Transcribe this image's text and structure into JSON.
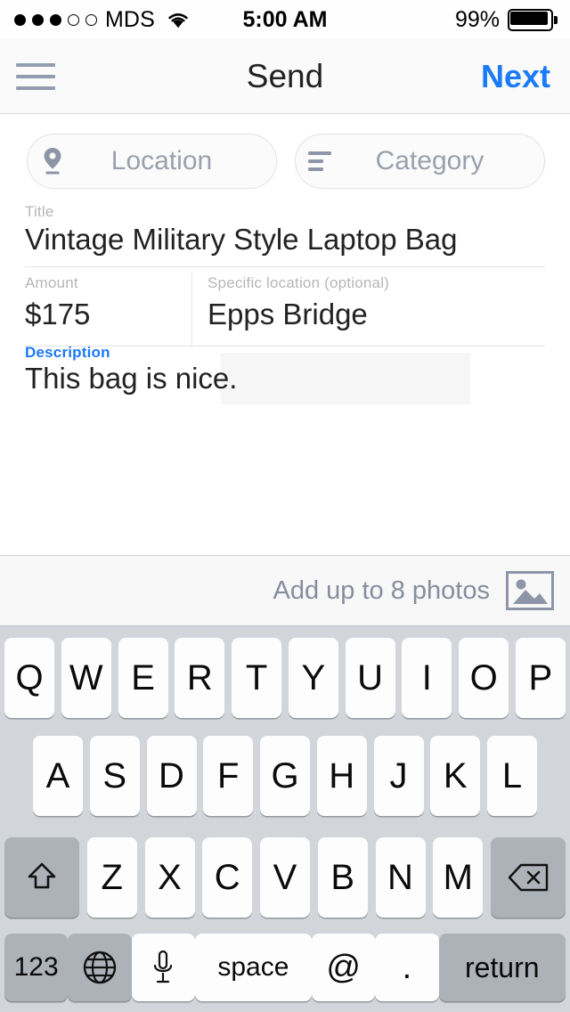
{
  "status_bar": {
    "signal_dots_filled": 3,
    "signal_dots_total": 5,
    "carrier": "MDS",
    "wifi_icon": "wifi-icon",
    "time": "5:00 AM",
    "battery_percent": "99%",
    "battery_icon": "battery-icon"
  },
  "nav": {
    "menu_icon": "hamburger-menu-icon",
    "title": "Send",
    "next_label": "Next"
  },
  "form": {
    "location_pill": {
      "icon": "map-pin-icon",
      "label": "Location"
    },
    "category_pill": {
      "icon": "list-lines-icon",
      "label": "Category"
    },
    "title_field": {
      "label": "Title",
      "value": "Vintage Military Style Laptop Bag"
    },
    "amount_field": {
      "label": "Amount",
      "value": "$175"
    },
    "specific_location_field": {
      "label": "Specific location (optional)",
      "value": "Epps Bridge"
    },
    "description_field": {
      "label": "Description",
      "value": "This bag is nice."
    }
  },
  "photos": {
    "label": "Add up to 8 photos",
    "icon": "photo-image-icon"
  },
  "keyboard": {
    "row1": [
      "Q",
      "W",
      "E",
      "R",
      "T",
      "Y",
      "U",
      "I",
      "O",
      "P"
    ],
    "row2": [
      "A",
      "S",
      "D",
      "F",
      "G",
      "H",
      "J",
      "K",
      "L"
    ],
    "row3_letters": [
      "Z",
      "X",
      "C",
      "V",
      "B",
      "N",
      "M"
    ],
    "shift_icon": "shift-arrow-icon",
    "backspace_icon": "backspace-delete-icon",
    "numbers_label": "123",
    "globe_icon": "globe-language-icon",
    "mic_icon": "microphone-icon",
    "space_label": "space",
    "at_label": "@",
    "period_label": ".",
    "return_label": "return"
  },
  "colors": {
    "accent_blue": "#1a7af8",
    "label_gray": "#b6b6b6",
    "icon_slate": "#8d96a8",
    "keyboard_bg": "#d2d5da",
    "key_white": "#fdfdfd",
    "key_dark": "#adb2b9"
  }
}
